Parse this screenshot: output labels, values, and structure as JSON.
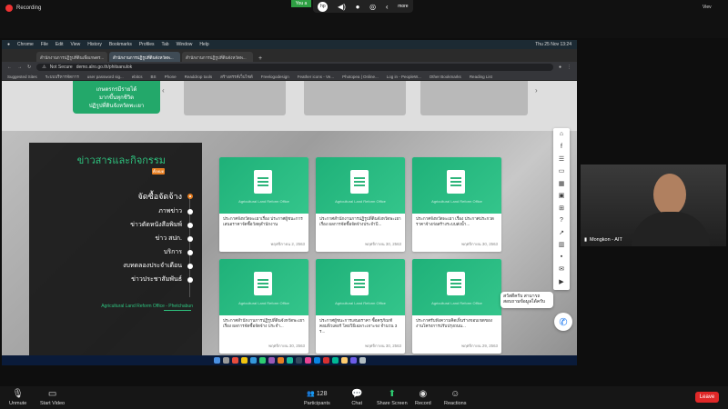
{
  "zoom": {
    "recording": "Recording",
    "you_label": "You a",
    "more_label": "more",
    "clock_right": "Viev"
  },
  "mac_menu": [
    "Chrome",
    "File",
    "Edit",
    "View",
    "History",
    "Bookmarks",
    "Profiles",
    "Tab",
    "Window",
    "Help"
  ],
  "mac_status": "Thu 25 Nov 13:24",
  "browser": {
    "tabs": [
      "สำนักงานการปฏิรูปที่ดินเพื่อเกษตร...",
      "สำนักงานการปฏิรูปที่ดินจังหวัดพ...",
      "สำนักงานการปฏิรูปที่ดินจังหวัดพ..."
    ],
    "not_secure": "Not Secure",
    "url": "demo.alro.go.th/phitsanulok",
    "bookmarks": [
      "Suggested Sites",
      "ระบบบริหารจัดการ",
      "user password sig...",
      "ebitcs",
      "BS",
      "Phone",
      "Readdrop tools",
      "สร้างสรรค์เว็บไซต์",
      "Freelogodesign",
      "Feather icons - Ve...",
      "Photopea | Online...",
      "Log in - PeopleW...",
      "Other Bookmarks",
      "Reading List"
    ]
  },
  "site": {
    "hero_button": [
      "เกษตรกรมีรายได้",
      "มากขึ้นทุกชีวิต",
      "ปฏิรูปที่ดินจังหวัดพะเยา"
    ],
    "news_title": "ข่าวสารและกิจกรรม",
    "all_badge": "ทั้งหมด",
    "menu": [
      "จัดซื้อจัดจ้าง",
      "ภาพข่าว",
      "ข่าวตัดหนังสือพิมพ์",
      "ข่าว สปก.",
      "บริการ",
      "งบทดลองประจำเดือน",
      "ข่าวประชาสัมพันธ์"
    ],
    "footer_text": "Agricultural Land Reform Office - Phetchabun",
    "card_watermark": "Agricultural Land Reform Office",
    "cards": [
      {
        "text": "ประกาศจังหวัดพะเยาเรื่อง ประกาศผู้ชนะการเสนอราคาจัดซื้อวัสดุสำนักงาน",
        "date": "พฤศจิกายน 2, 2563"
      },
      {
        "text": "ประกาศสำนักงานการปฏิรูปที่ดินจังหวัดพะเยา เรื่อง ผลการจัดซื้อจัดจ้างประจำปี...",
        "date": "พฤศจิกายน 30, 2563"
      },
      {
        "text": "ประกาศจังหวัดพะเยา เรื่อง ประกาศประกวดราคาจ้างก่อสร้างระบบส่งน้ำ...",
        "date": "พฤศจิกายน 30, 2563"
      },
      {
        "text": "ประกาศสำนักงานการปฏิรูปที่ดินจังหวัดพะเยา เรื่อง ผลการจัดซื้อจัดจ้าง ประจำ...",
        "date": "พฤศจิกายน 30, 2563"
      },
      {
        "text": "ประกาศผู้ชนะการเสนอราคา ซื้อครุภัณฑ์คอมพิวเตอร์ โดยวิธีเฉพาะเจาะจง จำนวน 3 ร...",
        "date": "พฤศจิกายน 30, 2563"
      },
      {
        "text": "ประกาศรับฟังความคิดเห็นร่างขอบเขตของงานโครงการปรับปรุงถนน...",
        "date": "พฤศจิกายน 29, 2563"
      }
    ],
    "side_icons": [
      "home-icon",
      "facebook-icon",
      "list-icon",
      "message-icon",
      "calendar-icon",
      "contact-icon",
      "sitemap-icon",
      "help-icon",
      "link-icon",
      "chart-icon",
      "lock-icon",
      "mail-icon",
      "video-icon"
    ],
    "chat_bubble": "สวัสดีครับ สามารถสอบถามข้อมูลได้ครับ"
  },
  "participant": {
    "name": "Mongkon - AIT"
  },
  "zoom_toolbar": {
    "unmute": "Unmute",
    "start_video": "Start Video",
    "participants": "Participants",
    "participants_count": "128",
    "chat": "Chat",
    "share_screen": "Share Screen",
    "record": "Record",
    "reactions": "Reactions",
    "leave": "Leave"
  },
  "colors": {
    "accent_green": "#23a86a",
    "badge_orange": "#e67e22",
    "leave_red": "#e02828"
  }
}
